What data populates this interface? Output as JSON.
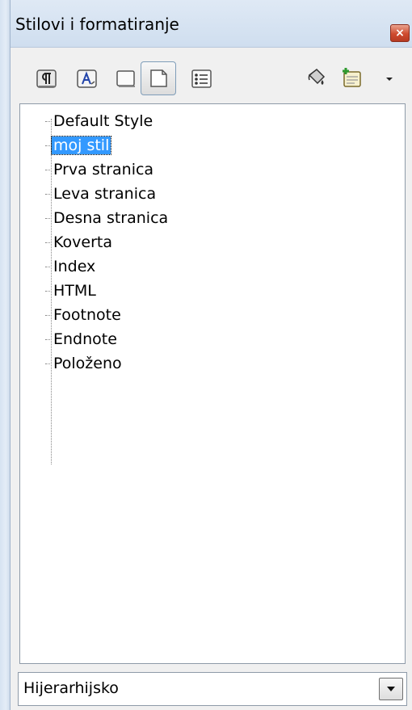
{
  "panel": {
    "title": "Stilovi i formatiranje",
    "close_label": "×"
  },
  "toolbar": {
    "buttons": [
      {
        "name": "paragraph-styles",
        "icon": "paragraph-styles-icon",
        "active": false
      },
      {
        "name": "character-styles",
        "icon": "character-styles-icon",
        "active": false
      },
      {
        "name": "frame-styles",
        "icon": "frame-styles-icon",
        "active": false
      },
      {
        "name": "page-styles",
        "icon": "page-styles-icon",
        "active": true
      },
      {
        "name": "list-styles",
        "icon": "list-styles-icon",
        "active": false
      },
      {
        "name": "fill-format-mode",
        "icon": "paint-bucket-icon",
        "active": false
      },
      {
        "name": "new-style-from-selection",
        "icon": "new-style-icon",
        "active": false
      }
    ]
  },
  "styles_tree": {
    "items": [
      {
        "label": "Default Style",
        "selected": false
      },
      {
        "label": "moj stil",
        "selected": true
      },
      {
        "label": "Prva stranica",
        "selected": false
      },
      {
        "label": "Leva stranica",
        "selected": false
      },
      {
        "label": "Desna stranica",
        "selected": false
      },
      {
        "label": "Koverta",
        "selected": false
      },
      {
        "label": "Index",
        "selected": false
      },
      {
        "label": "HTML",
        "selected": false
      },
      {
        "label": "Footnote",
        "selected": false
      },
      {
        "label": "Endnote",
        "selected": false
      },
      {
        "label": "Položeno",
        "selected": false
      }
    ]
  },
  "filter": {
    "value": "Hijerarhijsko"
  },
  "colors": {
    "selection": "#3399ff",
    "close_button": "#cf4b2f"
  }
}
